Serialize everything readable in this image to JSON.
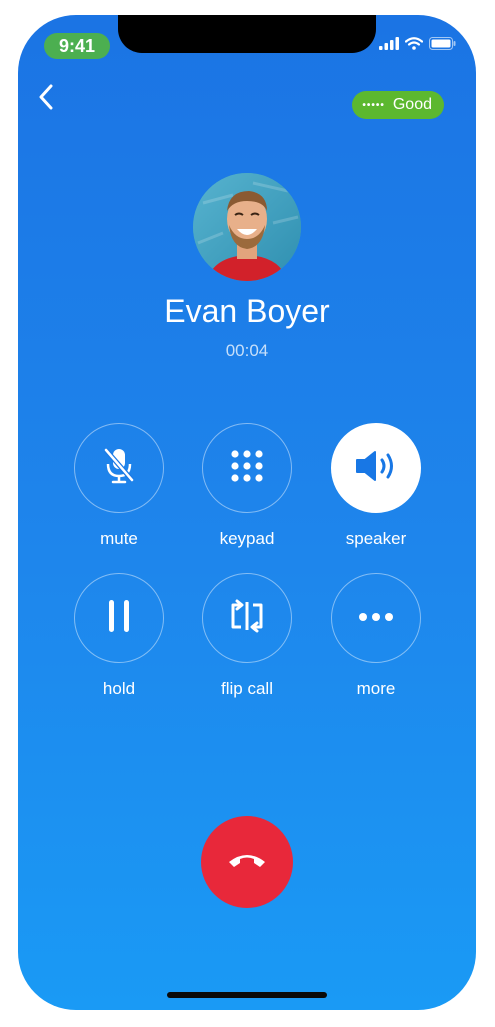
{
  "status_bar": {
    "time": "9:41"
  },
  "header": {
    "back_icon": "chevron-left-icon",
    "quality_dots": "•••••",
    "quality_label": "Good",
    "quality_color": "#5cb82f"
  },
  "caller": {
    "name": "Evan Boyer",
    "duration": "00:04"
  },
  "controls": [
    {
      "label": "mute",
      "icon": "mic-off-icon",
      "active": false
    },
    {
      "label": "keypad",
      "icon": "keypad-icon",
      "active": false
    },
    {
      "label": "speaker",
      "icon": "speaker-icon",
      "active": true
    },
    {
      "label": "hold",
      "icon": "pause-icon",
      "active": false
    },
    {
      "label": "flip call",
      "icon": "flip-call-icon",
      "active": false
    },
    {
      "label": "more",
      "icon": "more-dots-icon",
      "active": false
    }
  ],
  "end_call": {
    "icon": "hang-up-icon",
    "color": "#e8283a"
  },
  "colors": {
    "background_top": "#1b74e4",
    "background_bottom": "#1a9af5",
    "accent_blue": "#1877e5"
  }
}
